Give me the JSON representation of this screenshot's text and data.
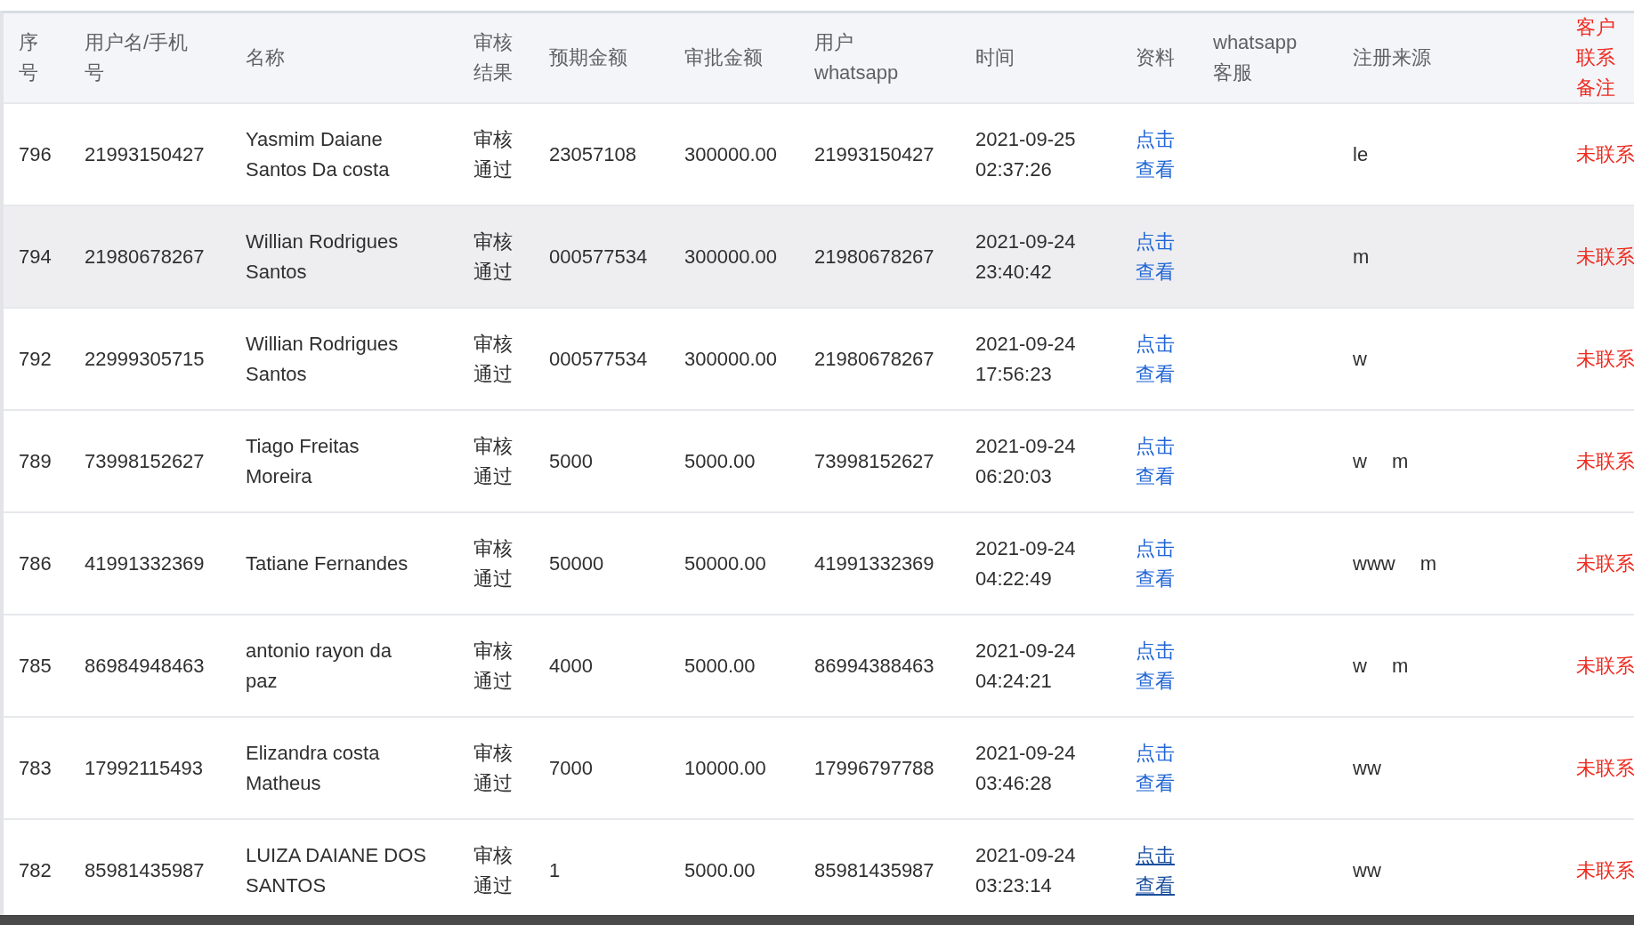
{
  "table": {
    "columns": [
      "序号",
      "用户名/手机号",
      "名称",
      "审核结果",
      "预期金额",
      "审批金额",
      "用户whatsapp",
      "时间",
      "资料",
      "whatsapp客服",
      "注册来源",
      "客户联系备注"
    ],
    "rows": [
      {
        "index": "796",
        "username": "21993150427",
        "name": "Yasmim Daiane Santos Da costa",
        "review": "审核通过",
        "expected": "23057108",
        "approved": "300000.00",
        "whatsapp": "21993150427",
        "time": "2021-09-25 02:37:26",
        "link": {
          "label": "点击查看",
          "hover": false
        },
        "source": [
          "le"
        ],
        "remark": "未联系",
        "highlighted": false
      },
      {
        "index": "794",
        "username": "21980678267",
        "name": "Willian Rodrigues Santos",
        "review": "审核通过",
        "expected": "000577534",
        "approved": "300000.00",
        "whatsapp": "21980678267",
        "time": "2021-09-24 23:40:42",
        "link": {
          "label": "点击查看",
          "hover": false
        },
        "source": [
          "m"
        ],
        "remark": "未联系",
        "highlighted": true
      },
      {
        "index": "792",
        "username": "22999305715",
        "name": "Willian Rodrigues Santos",
        "review": "审核通过",
        "expected": "000577534",
        "approved": "300000.00",
        "whatsapp": "21980678267",
        "time": "2021-09-24 17:56:23",
        "link": {
          "label": "点击查看",
          "hover": false
        },
        "source": [
          "w"
        ],
        "remark": "未联系",
        "highlighted": false
      },
      {
        "index": "789",
        "username": "73998152627",
        "name": "Tiago Freitas Moreira",
        "review": "审核通过",
        "expected": "5000",
        "approved": "5000.00",
        "whatsapp": "73998152627",
        "time": "2021-09-24 06:20:03",
        "link": {
          "label": "点击查看",
          "hover": false
        },
        "source": [
          "w",
          "m"
        ],
        "remark": "未联系",
        "highlighted": false
      },
      {
        "index": "786",
        "username": "41991332369",
        "name": "Tatiane Fernandes",
        "review": "审核通过",
        "expected": "50000",
        "approved": "50000.00",
        "whatsapp": "41991332369",
        "time": "2021-09-24 04:22:49",
        "link": {
          "label": "点击查看",
          "hover": false
        },
        "source": [
          "www",
          "m"
        ],
        "remark": "未联系",
        "highlighted": false
      },
      {
        "index": "785",
        "username": "86984948463",
        "name": "antonio rayon da paz",
        "review": "审核通过",
        "expected": "4000",
        "approved": "5000.00",
        "whatsapp": "86994388463",
        "time": "2021-09-24 04:24:21",
        "link": {
          "label": "点击查看",
          "hover": false
        },
        "source": [
          "w",
          "m"
        ],
        "remark": "未联系",
        "highlighted": false
      },
      {
        "index": "783",
        "username": "17992115493",
        "name": "Elizandra costa Matheus",
        "review": "审核通过",
        "expected": "7000",
        "approved": "10000.00",
        "whatsapp": "17996797788",
        "time": "2021-09-24 03:46:28",
        "link": {
          "label": "点击查看",
          "hover": false
        },
        "source": [
          "ww"
        ],
        "remark": "未联系",
        "highlighted": false
      },
      {
        "index": "782",
        "username": "85981435987",
        "name": "LUIZA DAIANE DOS SANTOS",
        "review": "审核通过",
        "expected": "1",
        "approved": "5000.00",
        "whatsapp": "85981435987",
        "time": "2021-09-24 03:23:14",
        "link": {
          "label": "点击查看",
          "hover": true
        },
        "source": [
          "ww"
        ],
        "remark": "未联系",
        "highlighted": false
      }
    ]
  }
}
